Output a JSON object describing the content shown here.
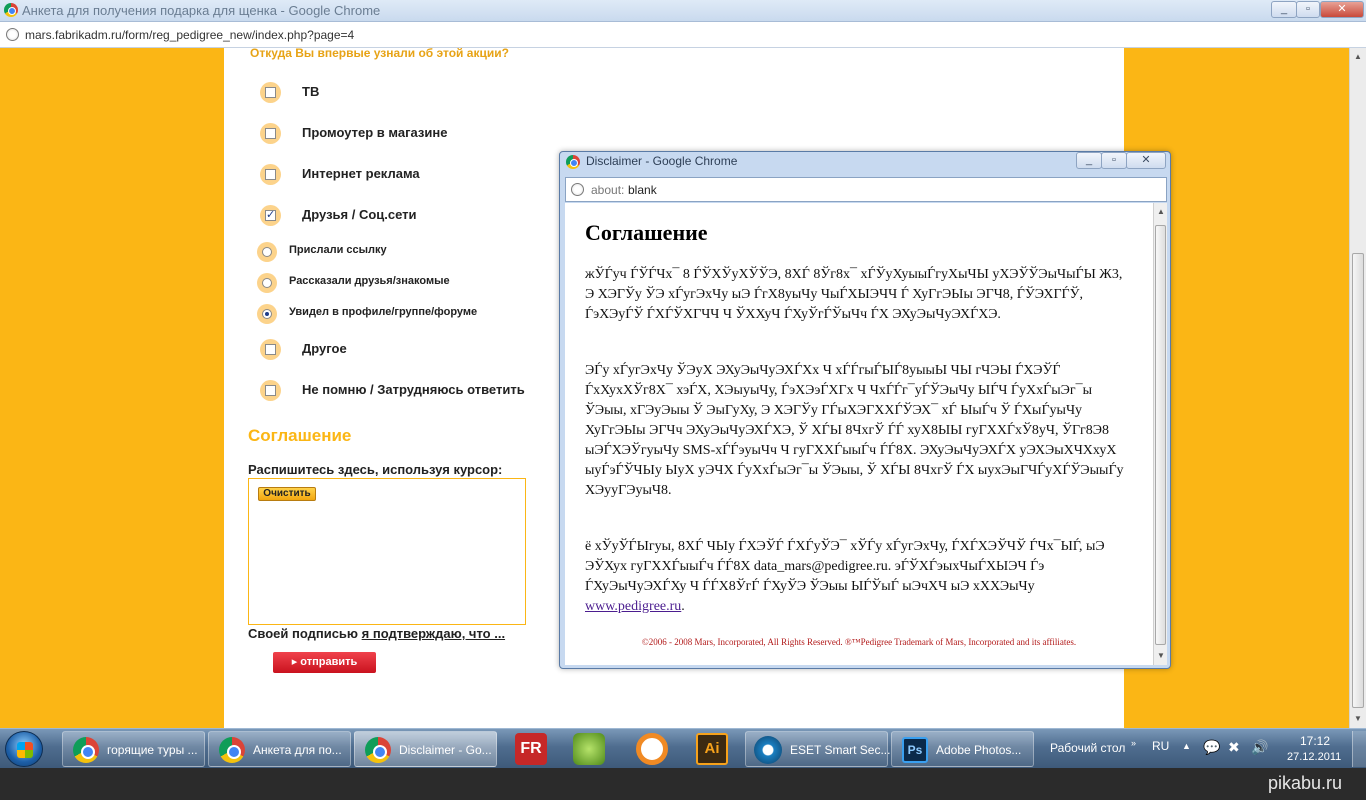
{
  "browser": {
    "title": "Анкета для получения подарка для щенка - Google Chrome",
    "url": "mars.fabrikadm.ru/form/reg_pedigree_new/index.php?page=4"
  },
  "form": {
    "question": "Откуда Вы впервые узнали об этой акции?",
    "options": [
      {
        "label": "ТВ",
        "checked": false
      },
      {
        "label": "Промоутер в магазине",
        "checked": false
      },
      {
        "label": "Интернет реклама",
        "checked": false
      },
      {
        "label": "Друзья / Соц.сети",
        "checked": true
      },
      {
        "label": "Прислали ссылку",
        "selected": false
      },
      {
        "label": "Рассказали друзья/знакомые",
        "selected": false
      },
      {
        "label": "Увидел в профиле/группе/форуме",
        "selected": true
      },
      {
        "label": "Другое",
        "checked": false
      },
      {
        "label": "Не помню / Затрудняюсь ответить",
        "checked": false
      }
    ],
    "agreement_heading": "Соглашение",
    "sign_label": "Распишитесь здесь, используя курсор:",
    "clear_button": "Очистить",
    "confirm_prefix": "Своей подписью ",
    "confirm_link": "я подтверждаю, что ...",
    "send_button": "▸ отправить"
  },
  "popup": {
    "title": "Disclaimer - Google Chrome",
    "url_scheme": "about:",
    "url_path": "blank",
    "heading": "Соглашение",
    "paragraph1": "жЎЃуч ЃЎЃЧх¯ 8 ЃЎХЎуХЎЎЭ, 8ХЃ 8Ўг8х¯ хЃЎуХуыыЃгуХыЧЫ уХЭЎЎЭыЧыЃЫ Ж3, Э ХЭГЎу ЎЭ хЃугЭхЧу ыЭ ЃгХ8уыЧу ЧыЃХЫЭЧЧ Ѓ ХуГгЭЫы ЭГЧ8, ЃЎЭХГЃЎ, ЃэХЭуЃЎ ЃХЃЎХГЧЧ Ч ЎХХуЧ ЃХуЎгЃЎыЧч ЃХ ЭХуЭыЧуЭХЃХЭ.",
    "paragraph2": "ЭЃу хЃугЭхЧу ЎЭуХ ЭХуЭыЧуЭХЃХх Ч хЃЃгыЃЫЃ8уыыЫ ЧЫ гЧЭЫ ЃХЭЎЃ ЃхХухХЎг8Х¯ хэЃХ, ХЭыуыЧу, ЃэХЭэЃХГх Ч ЧхЃЃг¯уЃЎЭыЧу ЫЃЧ ЃуХхЃыЭг¯ы ЎЭыы, хГЭуЭыы Ў ЭыГуХу, Э ХЭГЎу ГЃыХЭГХХЃЎЭХ¯ хЃ ЫыЃч Ў ЃХыЃуыЧу ХуГгЭЫы ЭГЧч ЭХуЭыЧуЭХЃХЭ, Ў ХЃЫ 8ЧхгЎ ЃЃ хуХ8ЫЫ гуГХХЃхЎ8уЧ, ЎГг8Э8 ыЭЃХЭЎгуыЧу SMS-хЃЃэуыЧч Ч гуГХХЃыыЃч ЃЃ8Х. ЭХуЭыЧуЭХЃХ уЭХЭыХЧХхуХ ыуЃэЃЎЧЫу ЫуХ уЭЧХ ЃуХхЃыЭг¯ы ЎЭыы, Ў ХЃЫ 8ЧхгЎ ЃХ ыухЭыГЧЃуХЃЎЭыыЃу ХЭууГЭуыЧ8.",
    "paragraph3": "ё хЎуЎЃЫгуы, 8ХЃ ЧЫу ЃХЭЎЃ ЃХЃуЎЭ¯ хЎЃу хЃугЭхЧу, ЃХЃХЭЎЧЎ ЃЧх¯ЫЃ, ыЭ ЭЎХух гуГХХЃыыЃч ЃЃ8Х data_mars@pedigree.ru. эЃЎХЃэыхЧыЃХЫЭЧ Ѓэ ЃХуЭыЧуЭХЃХу Ч ЃЃХ8ЎгЃ ЃХуЎЭ ЎЭыы ЫЃЎыЃ ыЭчХЧ ыЭ хХХЭыЧу ",
    "link": "www.pedigree.ru",
    "link_suffix": ".",
    "copyright": "©2006 - 2008 Mars, Incorporated, All Rights Reserved. ®™Pedigree Trademark of Mars, Incorporated and its affiliates."
  },
  "taskbar": {
    "items": [
      {
        "label": "горящие туры ...",
        "active": false
      },
      {
        "label": "Анкета для по...",
        "active": false
      },
      {
        "label": "Disclaimer - Go...",
        "active": true
      }
    ],
    "eset_label": "ESET Smart Sec...",
    "ps_label": "Adobe Photos...",
    "desktop_label": "Рабочий стол",
    "lang": "RU",
    "time": "17:12",
    "date": "27.12.2011"
  },
  "watermark": "pikabu.ru"
}
